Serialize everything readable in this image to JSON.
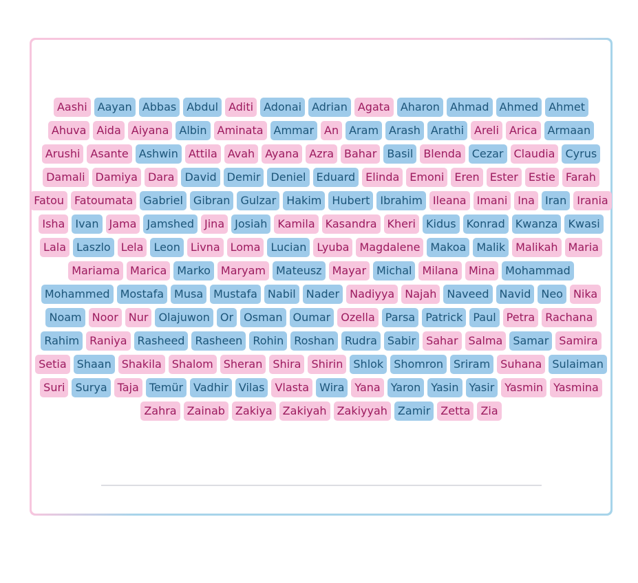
{
  "colors": {
    "pink_bg": "#f7c6de",
    "pink_text": "#9c1a5e",
    "blue_bg": "#9fcbea",
    "blue_text": "#1c5579"
  },
  "rows": [
    [
      [
        "Aashi",
        "p"
      ],
      [
        "Aayan",
        "b"
      ],
      [
        "Abbas",
        "b"
      ],
      [
        "Abdul",
        "b"
      ],
      [
        "Aditi",
        "p"
      ],
      [
        "Adonai",
        "b"
      ],
      [
        "Adrian",
        "b"
      ],
      [
        "Agata",
        "p"
      ],
      [
        "Aharon",
        "b"
      ],
      [
        "Ahmad",
        "b"
      ],
      [
        "Ahmed",
        "b"
      ],
      [
        "Ahmet",
        "b"
      ]
    ],
    [
      [
        "Ahuva",
        "p"
      ],
      [
        "Aida",
        "p"
      ],
      [
        "Aiyana",
        "p"
      ],
      [
        "Albin",
        "b"
      ],
      [
        "Aminata",
        "p"
      ],
      [
        "Ammar",
        "b"
      ],
      [
        "An",
        "p"
      ],
      [
        "Aram",
        "b"
      ],
      [
        "Arash",
        "b"
      ],
      [
        "Arathi",
        "b"
      ],
      [
        "Areli",
        "p"
      ],
      [
        "Arica",
        "p"
      ],
      [
        "Armaan",
        "b"
      ]
    ],
    [
      [
        "Arushi",
        "p"
      ],
      [
        "Asante",
        "p"
      ],
      [
        "Ashwin",
        "b"
      ],
      [
        "Attila",
        "p"
      ],
      [
        "Avah",
        "p"
      ],
      [
        "Ayana",
        "p"
      ],
      [
        "Azra",
        "p"
      ],
      [
        "Bahar",
        "p"
      ],
      [
        "Basil",
        "b"
      ],
      [
        "Blenda",
        "p"
      ],
      [
        "Cezar",
        "b"
      ],
      [
        "Claudia",
        "p"
      ],
      [
        "Cyrus",
        "b"
      ]
    ],
    [
      [
        "Damali",
        "p"
      ],
      [
        "Damiya",
        "p"
      ],
      [
        "Dara",
        "p"
      ],
      [
        "David",
        "b"
      ],
      [
        "Demir",
        "b"
      ],
      [
        "Deniel",
        "b"
      ],
      [
        "Eduard",
        "b"
      ],
      [
        "Elinda",
        "p"
      ],
      [
        "Emoni",
        "p"
      ],
      [
        "Eren",
        "p"
      ],
      [
        "Ester",
        "p"
      ],
      [
        "Estie",
        "p"
      ],
      [
        "Farah",
        "p"
      ]
    ],
    [
      [
        "Fatou",
        "p"
      ],
      [
        "Fatoumata",
        "p"
      ],
      [
        "Gabriel",
        "b"
      ],
      [
        "Gibran",
        "b"
      ],
      [
        "Gulzar",
        "b"
      ],
      [
        "Hakim",
        "b"
      ],
      [
        "Hubert",
        "b"
      ],
      [
        "Ibrahim",
        "b"
      ],
      [
        "Ileana",
        "p"
      ],
      [
        "Imani",
        "p"
      ],
      [
        "Ina",
        "p"
      ],
      [
        "Iran",
        "b"
      ],
      [
        "Irania",
        "p"
      ]
    ],
    [
      [
        "Isha",
        "p"
      ],
      [
        "Ivan",
        "b"
      ],
      [
        "Jama",
        "p"
      ],
      [
        "Jamshed",
        "b"
      ],
      [
        "Jina",
        "p"
      ],
      [
        "Josiah",
        "b"
      ],
      [
        "Kamila",
        "p"
      ],
      [
        "Kasandra",
        "p"
      ],
      [
        "Kheri",
        "p"
      ],
      [
        "Kidus",
        "b"
      ],
      [
        "Konrad",
        "b"
      ],
      [
        "Kwanza",
        "b"
      ],
      [
        "Kwasi",
        "b"
      ]
    ],
    [
      [
        "Lala",
        "p"
      ],
      [
        "Laszlo",
        "b"
      ],
      [
        "Lela",
        "p"
      ],
      [
        "Leon",
        "b"
      ],
      [
        "Livna",
        "p"
      ],
      [
        "Loma",
        "p"
      ],
      [
        "Lucian",
        "b"
      ],
      [
        "Lyuba",
        "p"
      ],
      [
        "Magdalene",
        "p"
      ],
      [
        "Makoa",
        "b"
      ],
      [
        "Malik",
        "b"
      ],
      [
        "Malikah",
        "p"
      ],
      [
        "Maria",
        "p"
      ]
    ],
    [
      [
        "Mariama",
        "p"
      ],
      [
        "Marica",
        "p"
      ],
      [
        "Marko",
        "b"
      ],
      [
        "Maryam",
        "p"
      ],
      [
        "Mateusz",
        "b"
      ],
      [
        "Mayar",
        "p"
      ],
      [
        "Michal",
        "b"
      ],
      [
        "Milana",
        "p"
      ],
      [
        "Mina",
        "p"
      ],
      [
        "Mohammad",
        "b"
      ]
    ],
    [
      [
        "Mohammed",
        "b"
      ],
      [
        "Mostafa",
        "b"
      ],
      [
        "Musa",
        "b"
      ],
      [
        "Mustafa",
        "b"
      ],
      [
        "Nabil",
        "b"
      ],
      [
        "Nader",
        "b"
      ],
      [
        "Nadiyya",
        "p"
      ],
      [
        "Najah",
        "p"
      ],
      [
        "Naveed",
        "b"
      ],
      [
        "Navid",
        "b"
      ],
      [
        "Neo",
        "b"
      ],
      [
        "Nika",
        "p"
      ]
    ],
    [
      [
        "Noam",
        "b"
      ],
      [
        "Noor",
        "p"
      ],
      [
        "Nur",
        "p"
      ],
      [
        "Olajuwon",
        "b"
      ],
      [
        "Or",
        "b"
      ],
      [
        "Osman",
        "b"
      ],
      [
        "Oumar",
        "b"
      ],
      [
        "Ozella",
        "p"
      ],
      [
        "Parsa",
        "b"
      ],
      [
        "Patrick",
        "b"
      ],
      [
        "Paul",
        "b"
      ],
      [
        "Petra",
        "p"
      ],
      [
        "Rachana",
        "p"
      ]
    ],
    [
      [
        "Rahim",
        "b"
      ],
      [
        "Raniya",
        "p"
      ],
      [
        "Rasheed",
        "b"
      ],
      [
        "Rasheen",
        "b"
      ],
      [
        "Rohin",
        "b"
      ],
      [
        "Roshan",
        "b"
      ],
      [
        "Rudra",
        "b"
      ],
      [
        "Sabir",
        "b"
      ],
      [
        "Sahar",
        "p"
      ],
      [
        "Salma",
        "p"
      ],
      [
        "Samar",
        "b"
      ],
      [
        "Samira",
        "p"
      ]
    ],
    [
      [
        "Setia",
        "p"
      ],
      [
        "Shaan",
        "b"
      ],
      [
        "Shakila",
        "p"
      ],
      [
        "Shalom",
        "p"
      ],
      [
        "Sheran",
        "p"
      ],
      [
        "Shira",
        "p"
      ],
      [
        "Shirin",
        "p"
      ],
      [
        "Shlok",
        "b"
      ],
      [
        "Shomron",
        "b"
      ],
      [
        "Sriram",
        "b"
      ],
      [
        "Suhana",
        "p"
      ],
      [
        "Sulaiman",
        "b"
      ]
    ],
    [
      [
        "Suri",
        "p"
      ],
      [
        "Surya",
        "b"
      ],
      [
        "Taja",
        "p"
      ],
      [
        "Temür",
        "b"
      ],
      [
        "Vadhir",
        "b"
      ],
      [
        "Vilas",
        "b"
      ],
      [
        "Vlasta",
        "p"
      ],
      [
        "Wira",
        "b"
      ],
      [
        "Yana",
        "p"
      ],
      [
        "Yaron",
        "b"
      ],
      [
        "Yasin",
        "b"
      ],
      [
        "Yasir",
        "b"
      ],
      [
        "Yasmin",
        "p"
      ],
      [
        "Yasmina",
        "p"
      ]
    ],
    [
      [
        "Zahra",
        "p"
      ],
      [
        "Zainab",
        "p"
      ],
      [
        "Zakiya",
        "p"
      ],
      [
        "Zakiyah",
        "p"
      ],
      [
        "Zakiyyah",
        "p"
      ],
      [
        "Zamir",
        "b"
      ],
      [
        "Zetta",
        "p"
      ],
      [
        "Zia",
        "p"
      ]
    ]
  ]
}
